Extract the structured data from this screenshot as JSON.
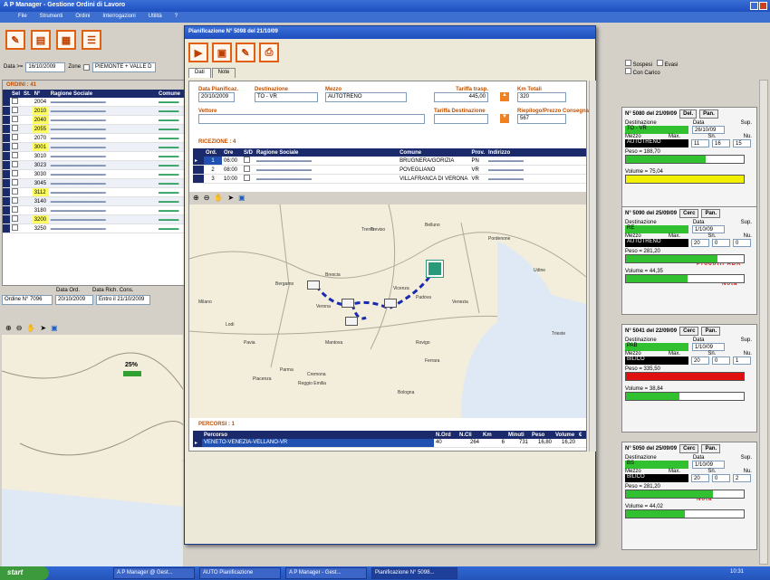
{
  "app": {
    "title": "A P Manager - Gestione Ordini di Lavoro",
    "menu": [
      "File",
      "Strumenti",
      "Ordini",
      "Interrogazioni",
      "Utilità",
      "?"
    ]
  },
  "filters": {
    "date_label": "Data >=",
    "date_value": "16/10/2009",
    "zone_label": "Zone",
    "zone_value": "PIEMONTE + VALLE D",
    "checkbox1": "Sospesi",
    "checkbox2": "Evasi",
    "checkbox3": "Con Carico"
  },
  "orders": {
    "title": "ORDINI : 41",
    "columns": [
      "Sel",
      "St.",
      "N°",
      "Ragione Sociale",
      "Comune"
    ],
    "rows": [
      {
        "n": "2004",
        "hl": false
      },
      {
        "n": "2010",
        "hl": true
      },
      {
        "n": "2040",
        "hl": true
      },
      {
        "n": "2055",
        "hl": true
      },
      {
        "n": "2070",
        "hl": false
      },
      {
        "n": "3001",
        "hl": true
      },
      {
        "n": "3010",
        "hl": false
      },
      {
        "n": "3023",
        "hl": false
      },
      {
        "n": "3030",
        "hl": false
      },
      {
        "n": "3045",
        "hl": false
      },
      {
        "n": "3112",
        "hl": true
      },
      {
        "n": "3140",
        "hl": false
      },
      {
        "n": "3180",
        "hl": false
      },
      {
        "n": "3200",
        "hl": true
      },
      {
        "n": "3250",
        "hl": false
      }
    ]
  },
  "bottom_left": {
    "date_label": "Data Ord.",
    "date2_label": "Data Rich. Cons.",
    "order_label": "Ordine N° 7096",
    "date_value": "20/10/2009",
    "date2_value": "Entro il 21/10/2009"
  },
  "map_main": {
    "percent": "25%"
  },
  "dialog": {
    "title": "Pianificazione N° 5098 del 21/10/09",
    "tabs": [
      "Dati",
      "Note"
    ],
    "fields": {
      "data_label": "Data Pianificaz.",
      "data_value": "20/10/2009",
      "dest_label": "Destinazione",
      "dest_value": "TO - VR",
      "mezzo_label": "Mezzo",
      "mezzo_value": "AUTOTRENO",
      "tariffa_label": "Tariffa trasp.",
      "tariffa_value": "445,00",
      "km_label": "Km Totali",
      "km_value": "320",
      "vettore_label": "Vettore",
      "vettore_value": "",
      "tariffa2_label": "Tariffa Destinazione",
      "tariffa2_value": "",
      "riep_label": "Riepilogo/Prezzo Consegna",
      "riep_value": "567"
    },
    "deliveries": {
      "title": "RICEZIONE : 4",
      "columns": [
        "Ord.",
        "Ore",
        "S/D",
        "Ragione Sociale",
        "Comune",
        "Prov.",
        "Indirizzo"
      ],
      "rows": [
        {
          "ord": "1",
          "ore": "06:00",
          "comune": "BRUGNERA/GORIZIA",
          "prov": "PN",
          "sel": true
        },
        {
          "ord": "2",
          "ore": "08:00",
          "comune": "POVEGLIANO",
          "prov": "VR",
          "sel": false
        },
        {
          "ord": "3",
          "ore": "10:00",
          "comune": "VILLAFRANCA DI VERONA",
          "prov": "VR",
          "sel": false
        }
      ]
    },
    "map_labels": [
      "Bergamo",
      "Brescia",
      "Treviso",
      "Padova",
      "Vicenza",
      "Verona",
      "Mantova",
      "Cremona",
      "Piacenza",
      "Parma",
      "Reggio Emilia",
      "Bologna",
      "Ferrara",
      "Lodi",
      "Milano",
      "Pavia",
      "Rovigo",
      "Venezia",
      "Trento",
      "Belluno",
      "Pordenone",
      "Udine",
      "Trieste"
    ],
    "routes": {
      "title": "PERCORSI : 1",
      "columns": [
        "Percorso",
        "N.Ord",
        "N.Cli",
        "Km",
        "Minuti",
        "Peso",
        "Volume",
        "€"
      ],
      "row": {
        "name": "VENETO-VENEZIA-VELLANO-VR",
        "nord": "40",
        "ncli": "264",
        "km": "6",
        "min": "731",
        "peso": "16,80",
        "vol": "16,20"
      }
    }
  },
  "cards": [
    {
      "title": "N° 5080 del 21/09/09",
      "btn1": "Del.",
      "btn2": "Pan.",
      "dest": "TO - VR",
      "date": "26/10/09",
      "mezzo": "AUTOTRENO",
      "m1": "11",
      "m2": "16",
      "m3": "15",
      "peso": "Peso = 188,70",
      "vol": "Volume = 75,04",
      "peso_pct": 0.68,
      "vol_pct": 1.0,
      "vol_color": "#f0f000",
      "warn": ""
    },
    {
      "title": "N° 5090 del 25/09/09",
      "btn1": "Cerc",
      "btn2": "Pan.",
      "dest": "RE",
      "date": "1/10/09",
      "mezzo": "AUTOTRENO",
      "m1": "20",
      "m2": "0",
      "m3": "0",
      "peso": "Peso = 281,20",
      "vol": "Volume = 44,35",
      "peso_pct": 0.78,
      "vol_pct": 0.52,
      "vol_color": "#30c030",
      "warn": "Prodotti ADR",
      "warn2": "Nota"
    },
    {
      "title": "N° 5041 del 22/09/09",
      "btn1": "Cerc",
      "btn2": "Pan.",
      "dest": "PAB",
      "date": "1/10/09",
      "mezzo": "BILICO",
      "m1": "20",
      "m2": "0",
      "m3": "1",
      "peso": "Peso = 335,50",
      "vol": "Volume = 38,84",
      "peso_pct": 1.0,
      "vol_pct": 0.45,
      "vol_color": "#30c030",
      "peso_color": "#e01010",
      "warn": ""
    },
    {
      "title": "N° 5050 del 25/09/09",
      "btn1": "Cerc",
      "btn2": "Pan.",
      "dest": "BS",
      "date": "1/10/09",
      "mezzo": "BILICO",
      "m1": "20",
      "m2": "0",
      "m3": "2",
      "peso": "Peso = 281,20",
      "vol": "Volume = 44,02",
      "peso_pct": 0.74,
      "vol_pct": 0.5,
      "vol_color": "#30c030",
      "warn": "Nota"
    }
  ],
  "card_labels": {
    "dest": "Destinazione",
    "date": "Data",
    "sup": "Sup.",
    "mezzo": "Mezzo",
    "max": "Max.",
    "sn": "Sn.",
    "nu": "Nu."
  },
  "taskbar": {
    "start": "start",
    "items": [
      "A P Manager @ Gest...",
      "AUTO Pianificazione",
      "A P Manager - Gest...",
      "Pianificazione N° 5098..."
    ],
    "clock": "10:31"
  }
}
